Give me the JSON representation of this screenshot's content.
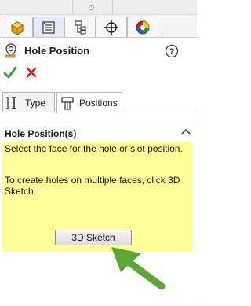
{
  "panel": {
    "title": "Hole Position",
    "tabs": [
      "feature-manager-icon",
      "property-manager-icon",
      "configuration-manager-icon",
      "dimxpert-manager-icon",
      "appearance-manager-icon"
    ],
    "active_tab": 1
  },
  "actions": {
    "ok_icon": "checkmark-icon",
    "cancel_icon": "x-icon",
    "help_icon": "question-icon"
  },
  "subtabs": {
    "type_label": "Type",
    "positions_label": "Positions",
    "active": "positions"
  },
  "section": {
    "title": "Hole Position(s)",
    "message_line1": "Select the face for the hole or slot position.",
    "message_line2": "To create holes on multiple faces, click 3D Sketch.",
    "button_label": "3D Sketch"
  },
  "colors": {
    "message_bg": "#ffff99",
    "ok_green": "#2e9e2e",
    "cancel_red": "#d42020",
    "arrow_green": "#5aa833"
  }
}
